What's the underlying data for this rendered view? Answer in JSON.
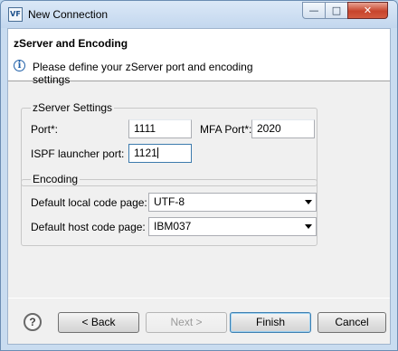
{
  "window": {
    "icon_text": "VF",
    "title": "New Connection"
  },
  "caption": {
    "minimize": "—",
    "maximize": "□",
    "close": "✕"
  },
  "banner": {
    "title": "zServer and Encoding",
    "icon": "info-icon",
    "description": "Please define your zServer port and encoding settings"
  },
  "zserver": {
    "group_title": "zServer Settings",
    "port_label": "Port*:",
    "port_value": "1111",
    "mfa_port_label": "MFA Port*:",
    "mfa_port_value": "2020",
    "ispf_label": "ISPF launcher port:",
    "ispf_value": "1121"
  },
  "encoding": {
    "group_title": "Encoding",
    "local_label": "Default local code page:",
    "local_value": "UTF-8",
    "host_label": "Default host code page:",
    "host_value": "IBM037"
  },
  "buttons": {
    "help": "?",
    "back": "< Back",
    "next": "Next >",
    "finish": "Finish",
    "cancel": "Cancel"
  }
}
